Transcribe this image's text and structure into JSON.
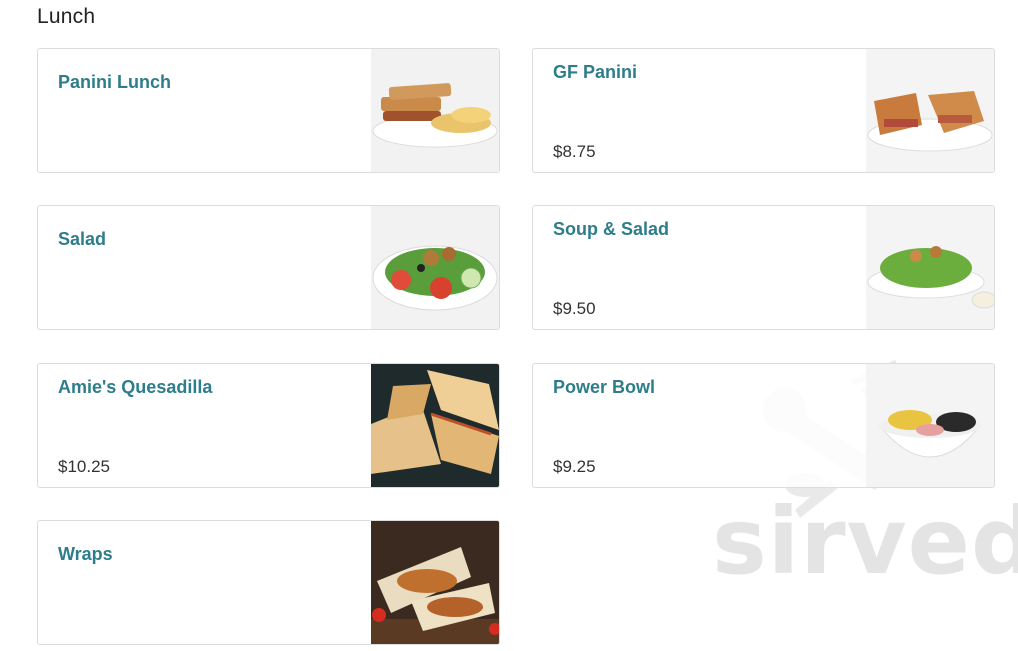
{
  "section": {
    "title": "Lunch"
  },
  "items": [
    {
      "name": "Panini Lunch",
      "price": ""
    },
    {
      "name": "GF Panini",
      "price": "$8.75"
    },
    {
      "name": "Salad",
      "price": ""
    },
    {
      "name": "Soup & Salad",
      "price": "$9.50"
    },
    {
      "name": "Amie's Quesadilla",
      "price": "$10.25"
    },
    {
      "name": "Power Bowl",
      "price": "$9.25"
    },
    {
      "name": "Wraps",
      "price": ""
    }
  ],
  "watermark": {
    "text": "sirved"
  },
  "colors": {
    "item_name": "#2e7d8a",
    "price": "#333333",
    "border": "#dcdcdc"
  }
}
